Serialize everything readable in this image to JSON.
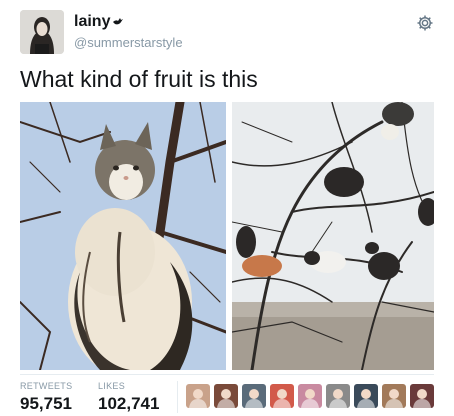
{
  "author": {
    "display_name": "lainy",
    "handle": "@summerstarstyle",
    "avatar_icon": "avatar-photo",
    "badge_icon": "bird-icon"
  },
  "settings_icon": "gear-icon",
  "tweet": {
    "text": "What kind of fruit is this"
  },
  "media": [
    {
      "description_icon": "cat-in-tree-photo-closeup"
    },
    {
      "description_icon": "cats-in-tree-photo-many"
    }
  ],
  "stats": {
    "retweets_label": "RETWEETS",
    "retweets_value": "95,751",
    "likes_label": "LIKES",
    "likes_value": "102,741"
  },
  "likers": [
    {
      "color": "#c9a28a"
    },
    {
      "color": "#7a4a3a"
    },
    {
      "color": "#5a6b7a"
    },
    {
      "color": "#d25a4a"
    },
    {
      "color": "#c98aa0"
    },
    {
      "color": "#8a8a8a"
    },
    {
      "color": "#3a4a5a"
    },
    {
      "color": "#a27a5a"
    },
    {
      "color": "#6a3a3a"
    }
  ],
  "colors": {
    "text": "#14171a",
    "secondary": "#8899a6",
    "divider": "#e6ecf0",
    "sky_left": "#b9cde6",
    "sky_right": "#e9ecee"
  }
}
